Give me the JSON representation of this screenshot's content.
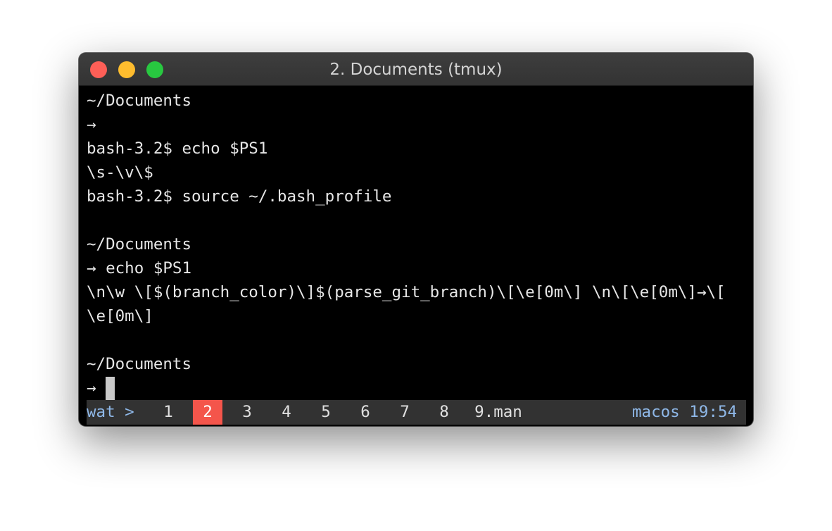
{
  "window": {
    "title": "2. Documents (tmux)"
  },
  "colors": {
    "close": "#fe5f57",
    "minimize": "#febc2e",
    "zoom": "#28c840",
    "accent_blue": "#8fb8e8",
    "active_window": "#f4554b",
    "status_bg": "#323232"
  },
  "terminal": {
    "lines": [
      "~/Documents",
      "→",
      "bash-3.2$ echo $PS1",
      "\\s-\\v\\$",
      "bash-3.2$ source ~/.bash_profile",
      "",
      "~/Documents",
      "→ echo $PS1",
      "\\n\\w \\[$(branch_color)\\]$(parse_git_branch)\\[\\e[0m\\] \\n\\[\\e[0m\\]→\\[",
      "\\e[0m\\]",
      "",
      "~/Documents",
      "→ "
    ]
  },
  "statusbar": {
    "session": "wat >",
    "windows": [
      {
        "label": "1",
        "active": false
      },
      {
        "label": "2",
        "active": true
      },
      {
        "label": "3",
        "active": false
      },
      {
        "label": "4",
        "active": false
      },
      {
        "label": "5",
        "active": false
      },
      {
        "label": "6",
        "active": false
      },
      {
        "label": "7",
        "active": false
      },
      {
        "label": "8",
        "active": false
      },
      {
        "label": "9.man",
        "active": false
      }
    ],
    "right": "macos 19:54"
  }
}
